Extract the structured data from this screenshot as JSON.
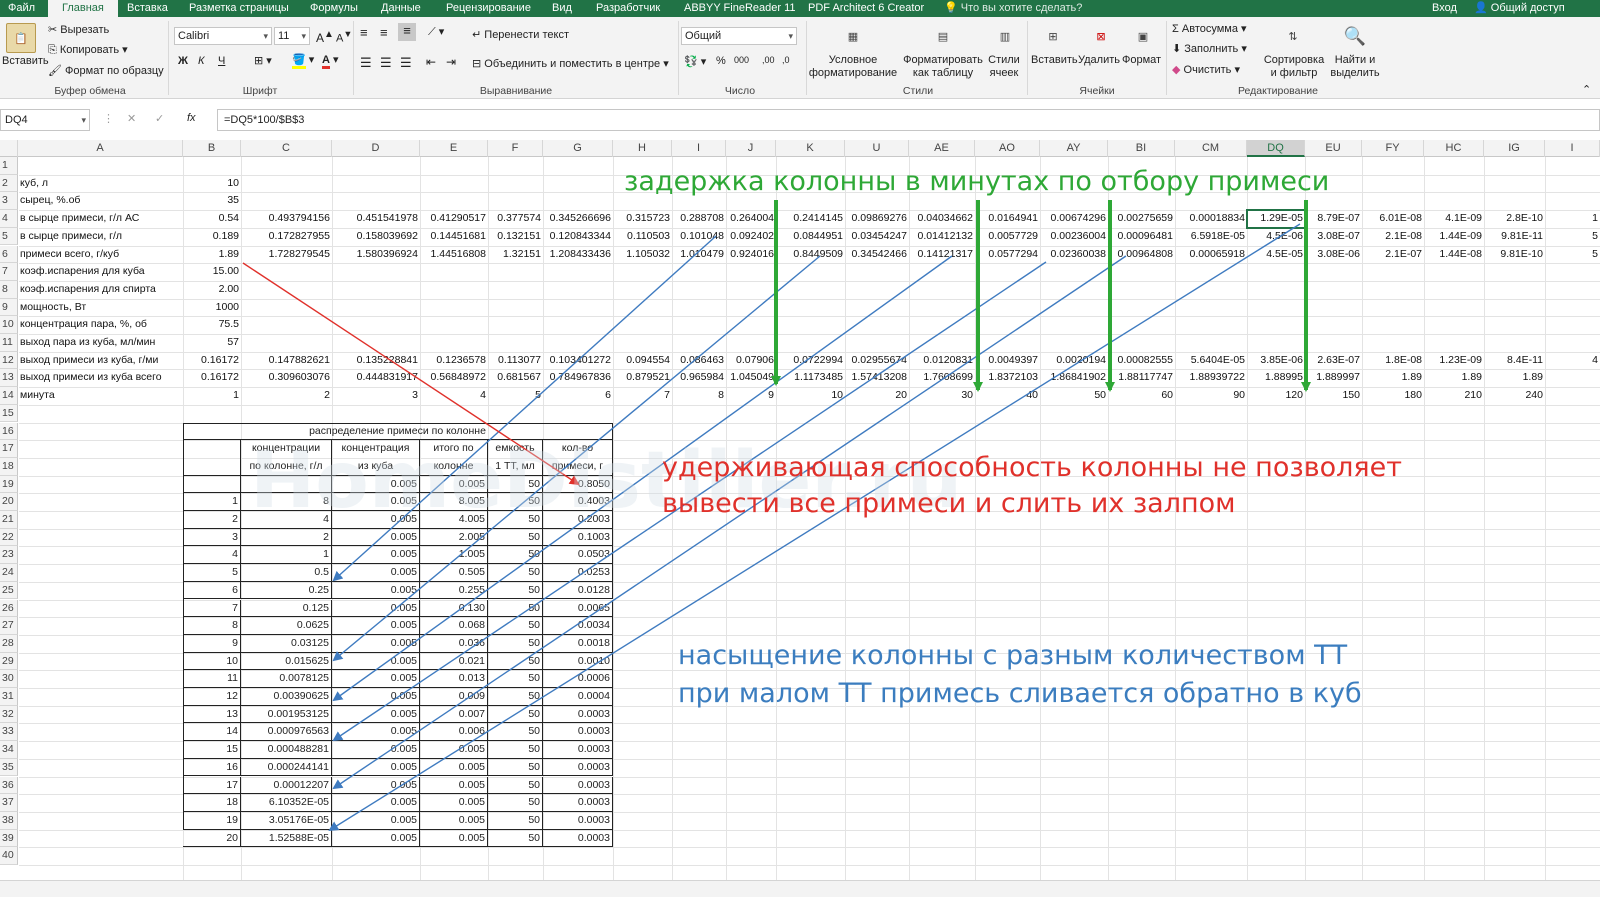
{
  "ribbon_tabs": [
    "Файл",
    "Главная",
    "Вставка",
    "Разметка страницы",
    "Формулы",
    "Данные",
    "Рецензирование",
    "Вид",
    "Разработчик",
    "ABBYY FineReader 11",
    "PDF Architect 6 Creator"
  ],
  "active_tab": "Главная",
  "tell_me": "Что вы хотите сделать?",
  "sign_in": "Вход",
  "share": "Общий доступ",
  "clipboard": {
    "paste": "Вставить",
    "cut": "Вырезать",
    "copy": "Копировать",
    "format_painter": "Формат по образцу",
    "label": "Буфер обмена"
  },
  "font": {
    "name": "Calibri",
    "size": "11",
    "bold": "Ж",
    "italic": "К",
    "underline": "Ч",
    "label": "Шрифт"
  },
  "alignment": {
    "wrap": "Перенести текст",
    "merge": "Объединить и поместить в центре",
    "label": "Выравнивание"
  },
  "number": {
    "format": "Общий",
    "label": "Число"
  },
  "styles": {
    "conditional": "Условное форматирование",
    "as_table": "Форматировать как таблицу",
    "cell_styles": "Стили ячеек",
    "label": "Стили"
  },
  "cells": {
    "insert": "Вставить",
    "delete": "Удалить",
    "format": "Формат",
    "label": "Ячейки"
  },
  "editing": {
    "autosum": "Автосумма",
    "fill": "Заполнить",
    "clear": "Очистить",
    "sort": "Сортировка и фильтр",
    "find": "Найти и выделить",
    "label": "Редактирование"
  },
  "name_box": "DQ4",
  "formula": "=DQ5*100/$B$3",
  "columns": [
    "A",
    "B",
    "C",
    "D",
    "E",
    "F",
    "G",
    "H",
    "I",
    "J",
    "K",
    "U",
    "AE",
    "AO",
    "AY",
    "BI",
    "CM",
    "DQ",
    "EU",
    "FY",
    "HC",
    "IG",
    "I"
  ],
  "selected_column": "DQ",
  "rows": {
    "r2": {
      "label": "куб, л",
      "b": "10"
    },
    "r3": {
      "label": "сырец, %.об",
      "b": "35"
    },
    "r4": {
      "label": "в сырце примеси, г/л АС",
      "vals": [
        "0.54",
        "0.493794156",
        "0.451541978",
        "0.41290517",
        "0.377574",
        "0.345266696",
        "0.315723",
        "0.288708",
        "0.264004",
        "0.2414145",
        "0.09869276",
        "0.04034662",
        "0.0164941",
        "0.00674296",
        "0.00275659",
        "0.00018834",
        "1.29E-05",
        "8.79E-07",
        "6.01E-08",
        "4.1E-09",
        "2.8E-10",
        "1"
      ]
    },
    "r5": {
      "label": "в сырце примеси, г/л",
      "vals": [
        "0.189",
        "0.172827955",
        "0.158039692",
        "0.14451681",
        "0.132151",
        "0.120843344",
        "0.110503",
        "0.101048",
        "0.092402",
        "0.0844951",
        "0.03454247",
        "0.01412132",
        "0.0057729",
        "0.00236004",
        "0.00096481",
        "6.5918E-05",
        "4.5E-06",
        "3.08E-07",
        "2.1E-08",
        "1.44E-09",
        "9.81E-11",
        "5"
      ]
    },
    "r6": {
      "label": "примеси всего, г/куб",
      "vals": [
        "1.89",
        "1.728279545",
        "1.580396924",
        "1.44516808",
        "1.32151",
        "1.208433436",
        "1.105032",
        "1.010479",
        "0.924016",
        "0.8449509",
        "0.34542466",
        "0.14121317",
        "0.0577294",
        "0.02360038",
        "0.00964808",
        "0.00065918",
        "4.5E-05",
        "3.08E-06",
        "2.1E-07",
        "1.44E-08",
        "9.81E-10",
        "5"
      ]
    },
    "r7": {
      "label": "коэф.испарения для куба",
      "b": "15.00"
    },
    "r8": {
      "label": "коэф.испарения для спирта",
      "b": "2.00"
    },
    "r9": {
      "label": "мощность, Вт",
      "b": "1000"
    },
    "r10": {
      "label": "концентрация пара, %, об",
      "b": "75.5"
    },
    "r11": {
      "label": "выход пара из куба, мл/мин",
      "b": "57"
    },
    "r12": {
      "label": "выход примеси из куба, г/ми",
      "vals": [
        "0.16172",
        "0.147882621",
        "0.135228841",
        "0.1236578",
        "0.113077",
        "0.103401272",
        "0.094554",
        "0.086463",
        "0.07906",
        "0.0722994",
        "0.02955674",
        "0.0120831",
        "0.0049397",
        "0.0020194",
        "0.00082555",
        "5.6404E-05",
        "3.85E-06",
        "2.63E-07",
        "1.8E-08",
        "1.23E-09",
        "8.4E-11",
        "4"
      ]
    },
    "r13": {
      "label": "выход примеси из куба всего",
      "vals": [
        "0.16172",
        "0.309603076",
        "0.444831917",
        "0.56848972",
        "0.681567",
        "0.784967836",
        "0.879521",
        "0.965984",
        "1.045049",
        "1.1173485",
        "1.57413208",
        "1.7608699",
        "1.8372103",
        "1.86841902",
        "1.88117747",
        "1.88939722",
        "1.88995",
        "1.889997",
        "1.89",
        "1.89",
        "1.89",
        ""
      ]
    },
    "r14": {
      "label": "минута",
      "vals": [
        "1",
        "2",
        "3",
        "4",
        "5",
        "6",
        "7",
        "8",
        "9",
        "10",
        "20",
        "30",
        "40",
        "50",
        "60",
        "90",
        "120",
        "150",
        "180",
        "210",
        "240",
        ""
      ]
    }
  },
  "dist_table": {
    "title": "распределение примеси по колонне",
    "headers": [
      [
        "",
        ""
      ],
      [
        "концентрации",
        "по колонне, г/л"
      ],
      [
        "концентрация",
        "из куба"
      ],
      [
        "итого по",
        "колонне"
      ],
      [
        "емкость",
        "1 ТТ, мл"
      ],
      [
        "кол-во",
        "примеси, г"
      ]
    ],
    "rows": [
      [
        "",
        "",
        "0.005",
        "0.005",
        "50",
        "0.8050"
      ],
      [
        "1",
        "8",
        "0.005",
        "8.005",
        "50",
        "0.4003"
      ],
      [
        "2",
        "4",
        "0.005",
        "4.005",
        "50",
        "0.2003"
      ],
      [
        "3",
        "2",
        "0.005",
        "2.005",
        "50",
        "0.1003"
      ],
      [
        "4",
        "1",
        "0.005",
        "1.005",
        "50",
        "0.0503"
      ],
      [
        "5",
        "0.5",
        "0.005",
        "0.505",
        "50",
        "0.0253"
      ],
      [
        "6",
        "0.25",
        "0.005",
        "0.255",
        "50",
        "0.0128"
      ],
      [
        "7",
        "0.125",
        "0.005",
        "0.130",
        "50",
        "0.0065"
      ],
      [
        "8",
        "0.0625",
        "0.005",
        "0.068",
        "50",
        "0.0034"
      ],
      [
        "9",
        "0.03125",
        "0.005",
        "0.036",
        "50",
        "0.0018"
      ],
      [
        "10",
        "0.015625",
        "0.005",
        "0.021",
        "50",
        "0.0010"
      ],
      [
        "11",
        "0.0078125",
        "0.005",
        "0.013",
        "50",
        "0.0006"
      ],
      [
        "12",
        "0.00390625",
        "0.005",
        "0.009",
        "50",
        "0.0004"
      ],
      [
        "13",
        "0.001953125",
        "0.005",
        "0.007",
        "50",
        "0.0003"
      ],
      [
        "14",
        "0.000976563",
        "0.005",
        "0.006",
        "50",
        "0.0003"
      ],
      [
        "15",
        "0.000488281",
        "0.005",
        "0.005",
        "50",
        "0.0003"
      ],
      [
        "16",
        "0.000244141",
        "0.005",
        "0.005",
        "50",
        "0.0003"
      ],
      [
        "17",
        "0.00012207",
        "0.005",
        "0.005",
        "50",
        "0.0003"
      ],
      [
        "18",
        "6.10352E-05",
        "0.005",
        "0.005",
        "50",
        "0.0003"
      ],
      [
        "19",
        "3.05176E-05",
        "0.005",
        "0.005",
        "50",
        "0.0003"
      ],
      [
        "20",
        "1.52588E-05",
        "0.005",
        "0.005",
        "50",
        "0.0003"
      ]
    ]
  },
  "annotations": {
    "green": "задержка колонны в минутах по отбору примеси",
    "red_1": "удерживающая способность колонны не позволяет",
    "red_2": "вывести все примеси и слить их залпом",
    "blue_1": "насыщение колонны с разным количеством ТТ",
    "blue_2": "при малом ТТ примесь сливается обратно в куб",
    "watermark": "HomeDistiller.ru"
  },
  "colors": {
    "excel_green": "#217346",
    "annot_green": "#2ea836",
    "annot_red": "#e0312b",
    "annot_blue": "#3b7dbf",
    "arrow_red": "#e0312b",
    "arrow_blue": "#3f7bc0"
  }
}
